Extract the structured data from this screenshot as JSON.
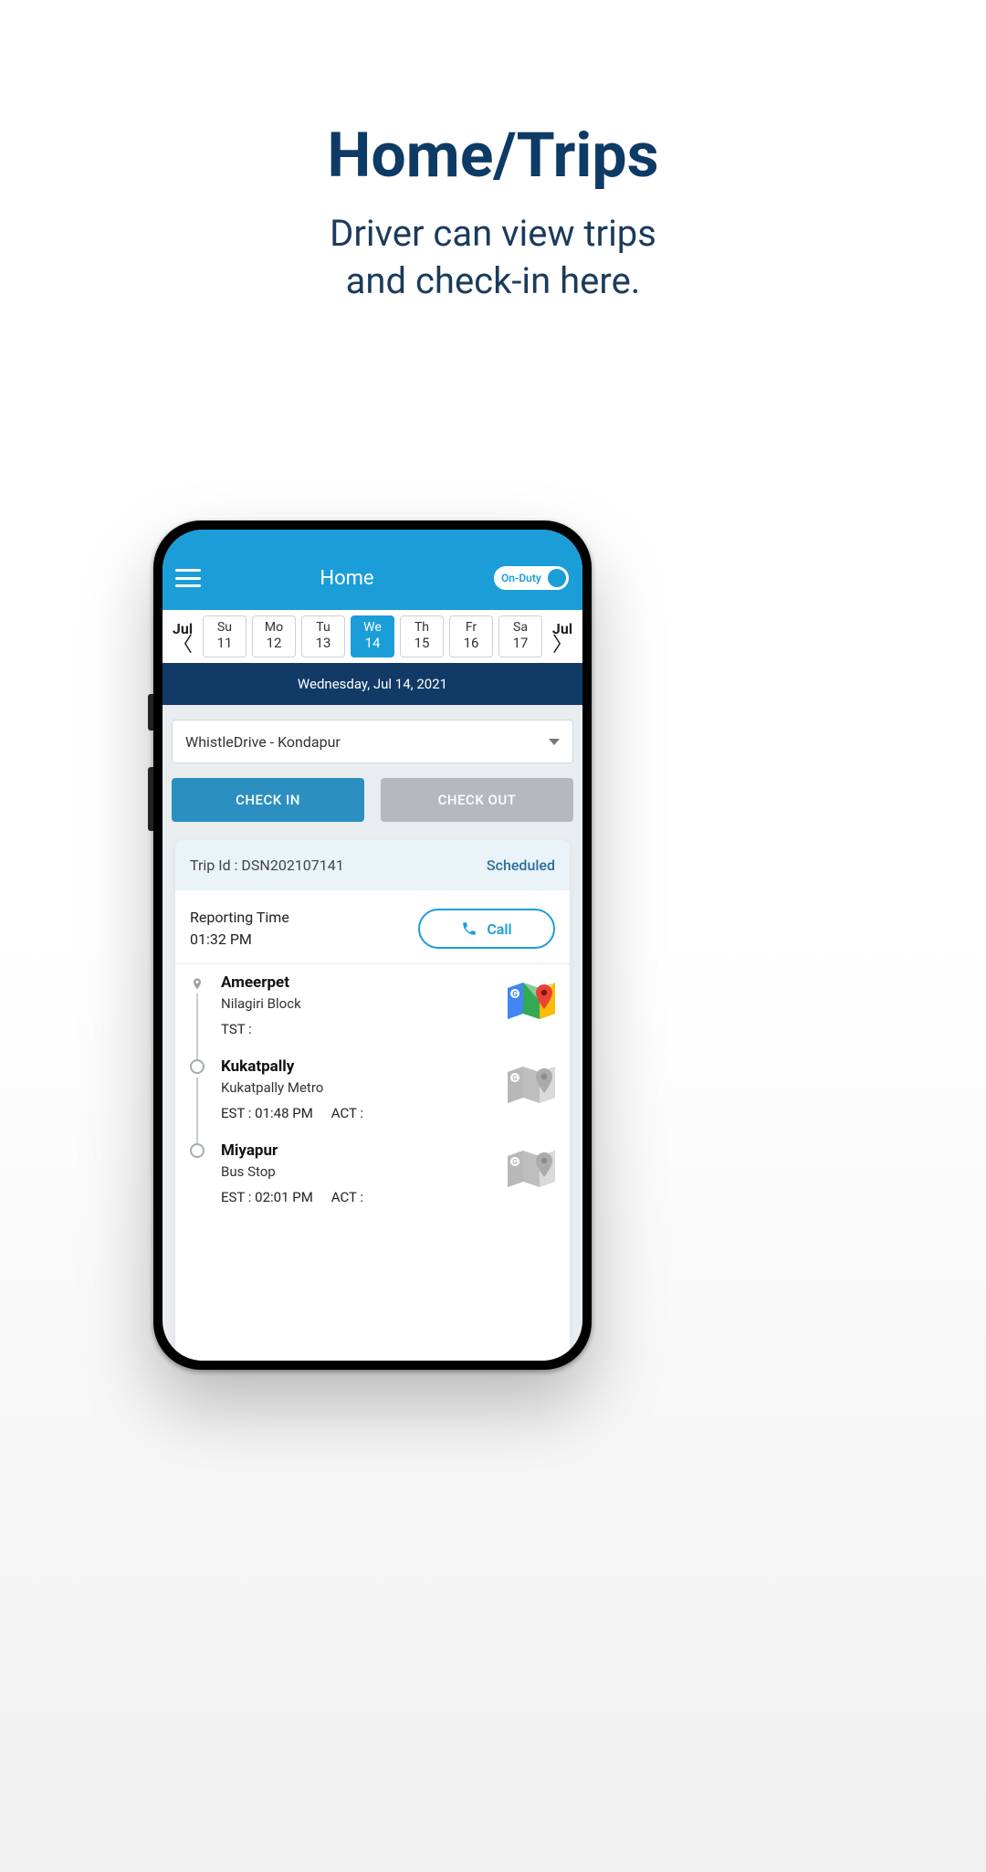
{
  "marketing": {
    "title": "Home/Trips",
    "subtitle_l1": "Driver can view trips",
    "subtitle_l2": "and check-in here."
  },
  "header": {
    "title": "Home",
    "duty_label": "On-Duty"
  },
  "calendar": {
    "month_left_label": "Jul",
    "month_right_label": "Jul",
    "days": [
      {
        "short": "Su",
        "num": "11",
        "active": false
      },
      {
        "short": "Mo",
        "num": "12",
        "active": false
      },
      {
        "short": "Tu",
        "num": "13",
        "active": false
      },
      {
        "short": "We",
        "num": "14",
        "active": true
      },
      {
        "short": "Th",
        "num": "15",
        "active": false
      },
      {
        "short": "Fr",
        "num": "16",
        "active": false
      },
      {
        "short": "Sa",
        "num": "17",
        "active": false
      }
    ],
    "selected_date_label": "Wednesday,  Jul 14, 2021"
  },
  "location_select": {
    "value": "WhistleDrive - Kondapur"
  },
  "actions": {
    "checkin": "CHECK IN",
    "checkout": "CHECK OUT"
  },
  "trip": {
    "trip_id_label": "Trip Id : DSN202107141",
    "status": "Scheduled",
    "reporting_label": "Reporting Time",
    "reporting_time": "01:32 PM",
    "call_label": "Call",
    "stops": [
      {
        "name": "Ameerpet",
        "sub": "Nilagiri Block",
        "meta1": "TST :",
        "meta2": "",
        "marker": "pin",
        "map_enabled": true
      },
      {
        "name": "Kukatpally",
        "sub": "Kukatpally Metro",
        "meta1": "EST : 01:48 PM",
        "meta2": "ACT :",
        "marker": "circle",
        "map_enabled": false
      },
      {
        "name": "Miyapur",
        "sub": "Bus Stop",
        "meta1": "EST : 02:01 PM",
        "meta2": "ACT :",
        "marker": "circle",
        "map_enabled": false
      }
    ]
  }
}
